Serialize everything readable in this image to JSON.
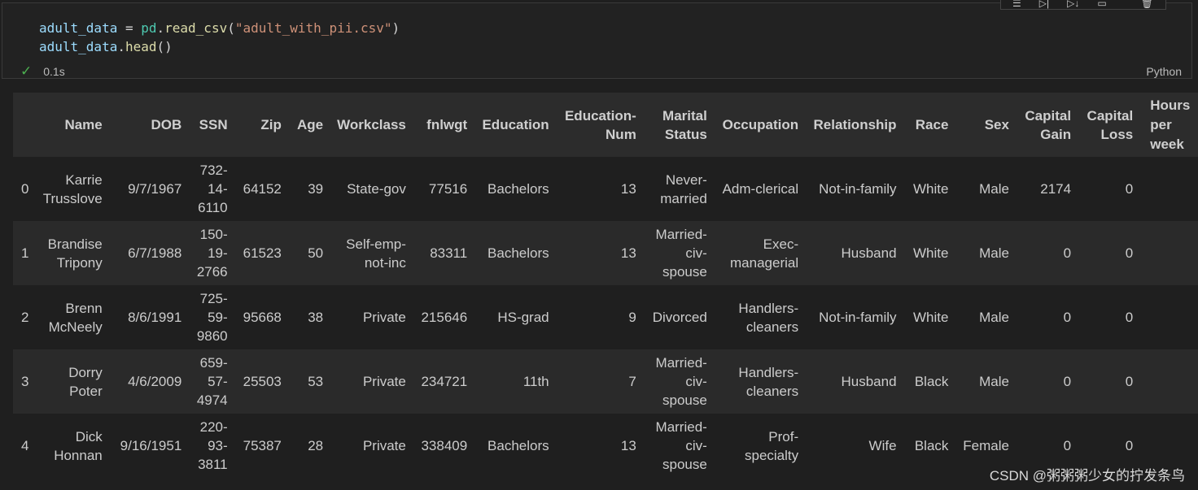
{
  "cell": {
    "code": {
      "l1": {
        "var": "adult_data",
        "eq": " = ",
        "mod": "pd",
        "dot": ".",
        "fn": "read_csv",
        "open": "(",
        "str": "\"adult_with_pii.csv\"",
        "close": ")"
      },
      "l2": {
        "var": "adult_data",
        "dot": ".",
        "fn": "head",
        "paren": "()"
      }
    },
    "status": {
      "icon": "check-icon",
      "time": "0.1s"
    },
    "language": "Python",
    "toolbar_icons": [
      "run-by-line-icon",
      "execute-above-icon",
      "execute-below-icon",
      "split-cell-icon",
      "delete-icon"
    ]
  },
  "table": {
    "columns": [
      "",
      "Name",
      "DOB",
      "SSN",
      "Zip",
      "Age",
      "Workclass",
      "fnlwgt",
      "Education",
      "Education-Num",
      "Marital Status",
      "Occupation",
      "Relationship",
      "Race",
      "Sex",
      "Capital Gain",
      "Capital Loss",
      "Hours per week"
    ],
    "rows": [
      [
        "0",
        "Karrie Trusslove",
        "9/7/1967",
        "732-14-6110",
        "64152",
        "39",
        "State-gov",
        "77516",
        "Bachelors",
        "13",
        "Never-married",
        "Adm-clerical",
        "Not-in-family",
        "White",
        "Male",
        "2174",
        "0",
        ""
      ],
      [
        "1",
        "Brandise Tripony",
        "6/7/1988",
        "150-19-2766",
        "61523",
        "50",
        "Self-emp-not-inc",
        "83311",
        "Bachelors",
        "13",
        "Married-civ-spouse",
        "Exec-managerial",
        "Husband",
        "White",
        "Male",
        "0",
        "0",
        ""
      ],
      [
        "2",
        "Brenn McNeely",
        "8/6/1991",
        "725-59-9860",
        "95668",
        "38",
        "Private",
        "215646",
        "HS-grad",
        "9",
        "Divorced",
        "Handlers-cleaners",
        "Not-in-family",
        "White",
        "Male",
        "0",
        "0",
        ""
      ],
      [
        "3",
        "Dorry Poter",
        "4/6/2009",
        "659-57-4974",
        "25503",
        "53",
        "Private",
        "234721",
        "11th",
        "7",
        "Married-civ-spouse",
        "Handlers-cleaners",
        "Husband",
        "Black",
        "Male",
        "0",
        "0",
        ""
      ],
      [
        "4",
        "Dick Honnan",
        "9/16/1951",
        "220-93-3811",
        "75387",
        "28",
        "Private",
        "338409",
        "Bachelors",
        "13",
        "Married-civ-spouse",
        "Prof-specialty",
        "Wife",
        "Black",
        "Female",
        "0",
        "0",
        ""
      ]
    ]
  },
  "watermark": "CSDN @粥粥粥少女的拧发条鸟"
}
